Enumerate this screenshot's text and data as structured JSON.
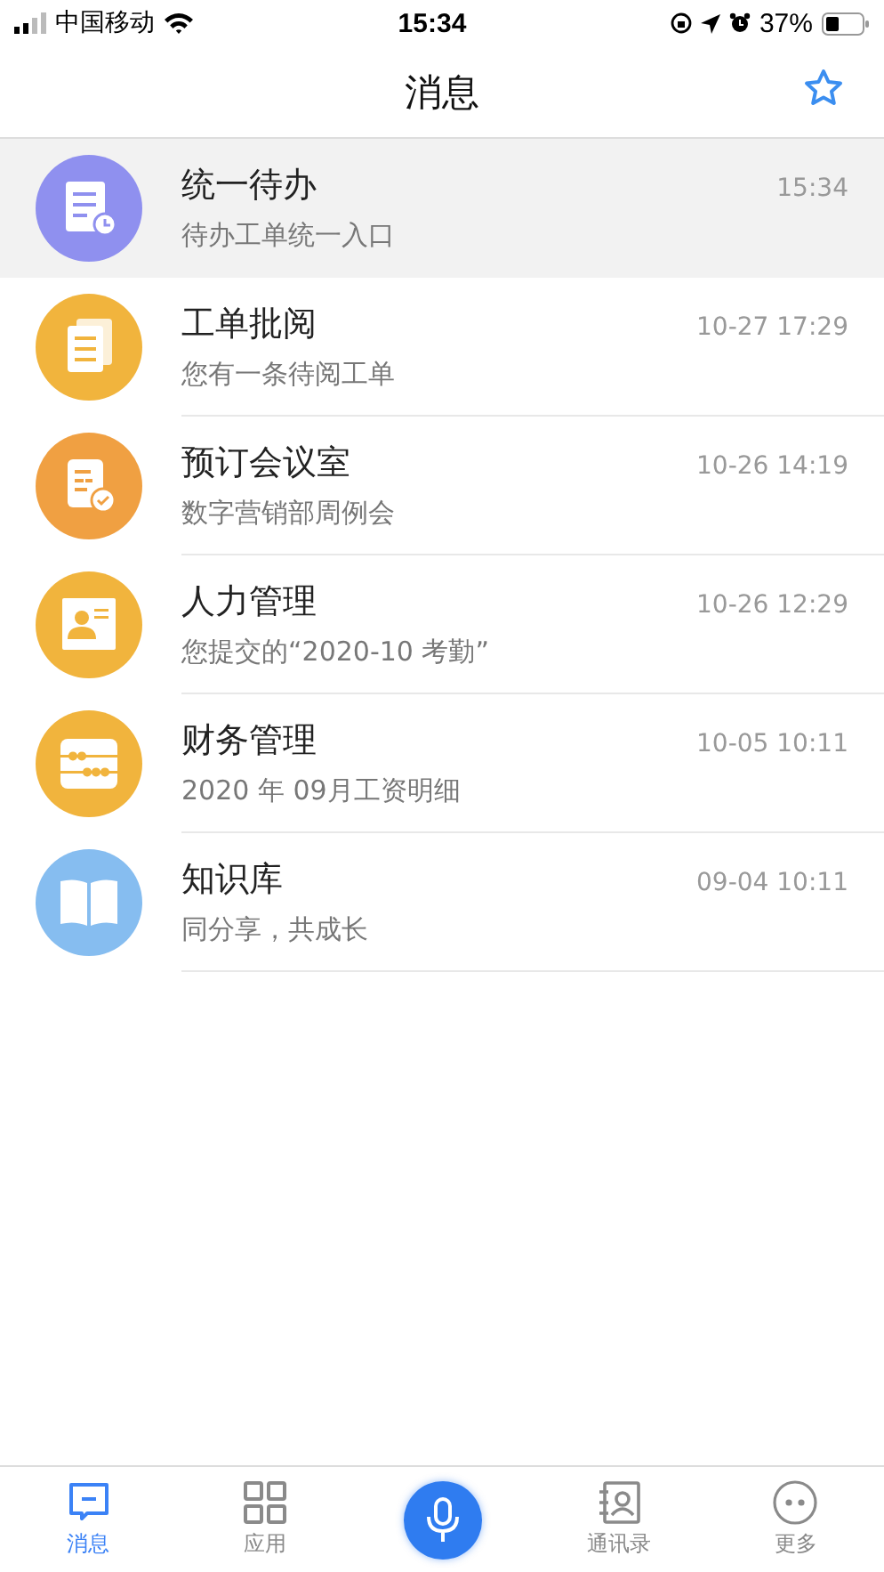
{
  "status_bar": {
    "carrier": "中国移动",
    "time": "15:34",
    "battery": "37%"
  },
  "nav": {
    "title": "消息"
  },
  "messages": [
    {
      "title": "统一待办",
      "subtitle": "待办工单统一入口",
      "time": "15:34",
      "kind": "todo",
      "color": "#8f90ef",
      "selected": true
    },
    {
      "title": "工单批阅",
      "subtitle": "您有一条待阅工单",
      "time": "10-27 17:29",
      "kind": "docs",
      "color": "#f1b43d",
      "selected": false
    },
    {
      "title": "预订会议室",
      "subtitle": "数字营销部周例会",
      "time": "10-26 14:19",
      "kind": "meeting",
      "color": "#f0a042",
      "selected": false
    },
    {
      "title": "人力管理",
      "subtitle": "您提交的“2020-10 考勤”",
      "time": "10-26 12:29",
      "kind": "hr",
      "color": "#f1b43d",
      "selected": false
    },
    {
      "title": "财务管理",
      "subtitle": "2020 年 09月工资明细",
      "time": "10-05 10:11",
      "kind": "finance",
      "color": "#f1b43d",
      "selected": false
    },
    {
      "title": "知识库",
      "subtitle": "同分享，共成长",
      "time": "09-04 10:11",
      "kind": "book",
      "color": "#86bdf0",
      "selected": false
    }
  ],
  "tab_bar": [
    {
      "kind": "messages",
      "label": "消息",
      "selected": true
    },
    {
      "kind": "apps",
      "label": "应用",
      "selected": false
    },
    {
      "kind": "voice"
    },
    {
      "kind": "contacts",
      "label": "通讯录",
      "selected": false
    },
    {
      "kind": "more",
      "label": "更多",
      "selected": false
    }
  ]
}
